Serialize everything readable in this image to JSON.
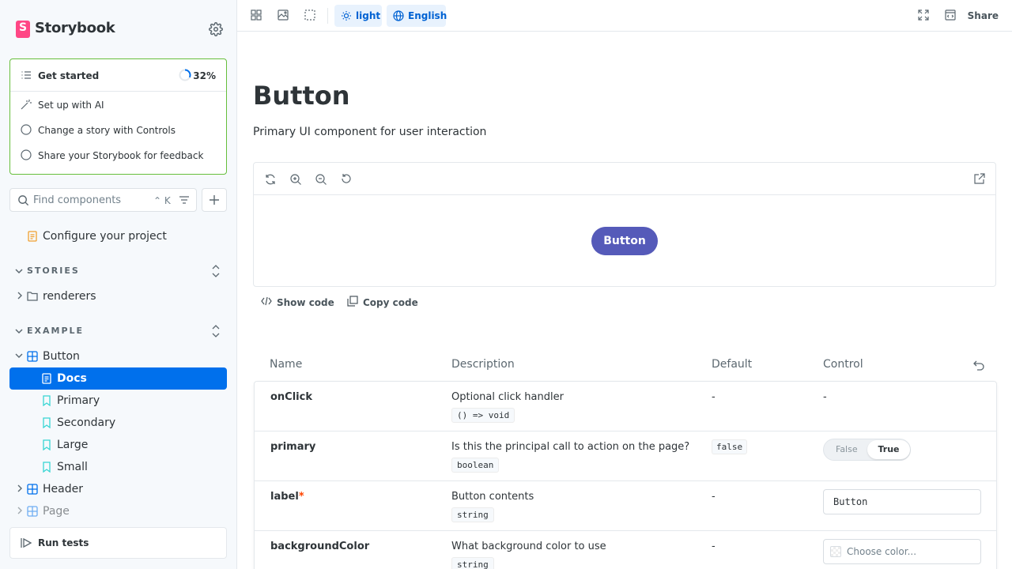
{
  "app": {
    "name": "Storybook"
  },
  "get_started": {
    "title": "Get started",
    "progress_percent": 32,
    "progress_label": "32%",
    "items": [
      "Set up with AI",
      "Change a story with Controls",
      "Share your Storybook for feedback"
    ]
  },
  "search": {
    "placeholder": "Find components",
    "shortcut": "⌃ K"
  },
  "sidebar": {
    "configure": "Configure your project",
    "sections": [
      {
        "title": "STORIES",
        "items": [
          "renderers"
        ]
      },
      {
        "title": "EXAMPLE"
      }
    ],
    "example_items": {
      "button": "Button",
      "children": [
        "Docs",
        "Primary",
        "Secondary",
        "Large",
        "Small"
      ],
      "header": "Header",
      "page": "Page"
    },
    "run_tests": "Run tests"
  },
  "toolbar": {
    "theme": "light",
    "locale": "English",
    "share": "Share"
  },
  "doc": {
    "title": "Button",
    "subtitle": "Primary UI component for user interaction",
    "demo_button": "Button",
    "show_code": "Show code",
    "copy_code": "Copy code"
  },
  "args_table": {
    "headers": [
      "Name",
      "Description",
      "Default",
      "Control"
    ],
    "rows": [
      {
        "name": "onClick",
        "required": "",
        "description": "Optional click handler",
        "type": "() => void",
        "default": "-",
        "control": "-"
      },
      {
        "name": "primary",
        "required": "",
        "description": "Is this the principal call to action on the page?",
        "type": "boolean",
        "default": "false",
        "toggle_off": "False",
        "toggle_on": "True"
      },
      {
        "name": "label",
        "required": "*",
        "description": "Button contents",
        "type": "string",
        "default": "-",
        "control_value": "Button"
      },
      {
        "name": "backgroundColor",
        "required": "",
        "description": "What background color to use",
        "type": "string",
        "default": "-",
        "control_placeholder": "Choose color..."
      }
    ]
  },
  "colors": {
    "brand": "#ff4785",
    "selected": "#0070ec",
    "accent_pill": "#e8f2fd",
    "demo_button": "#555ab9",
    "get_started_border": "#66bf3c"
  }
}
